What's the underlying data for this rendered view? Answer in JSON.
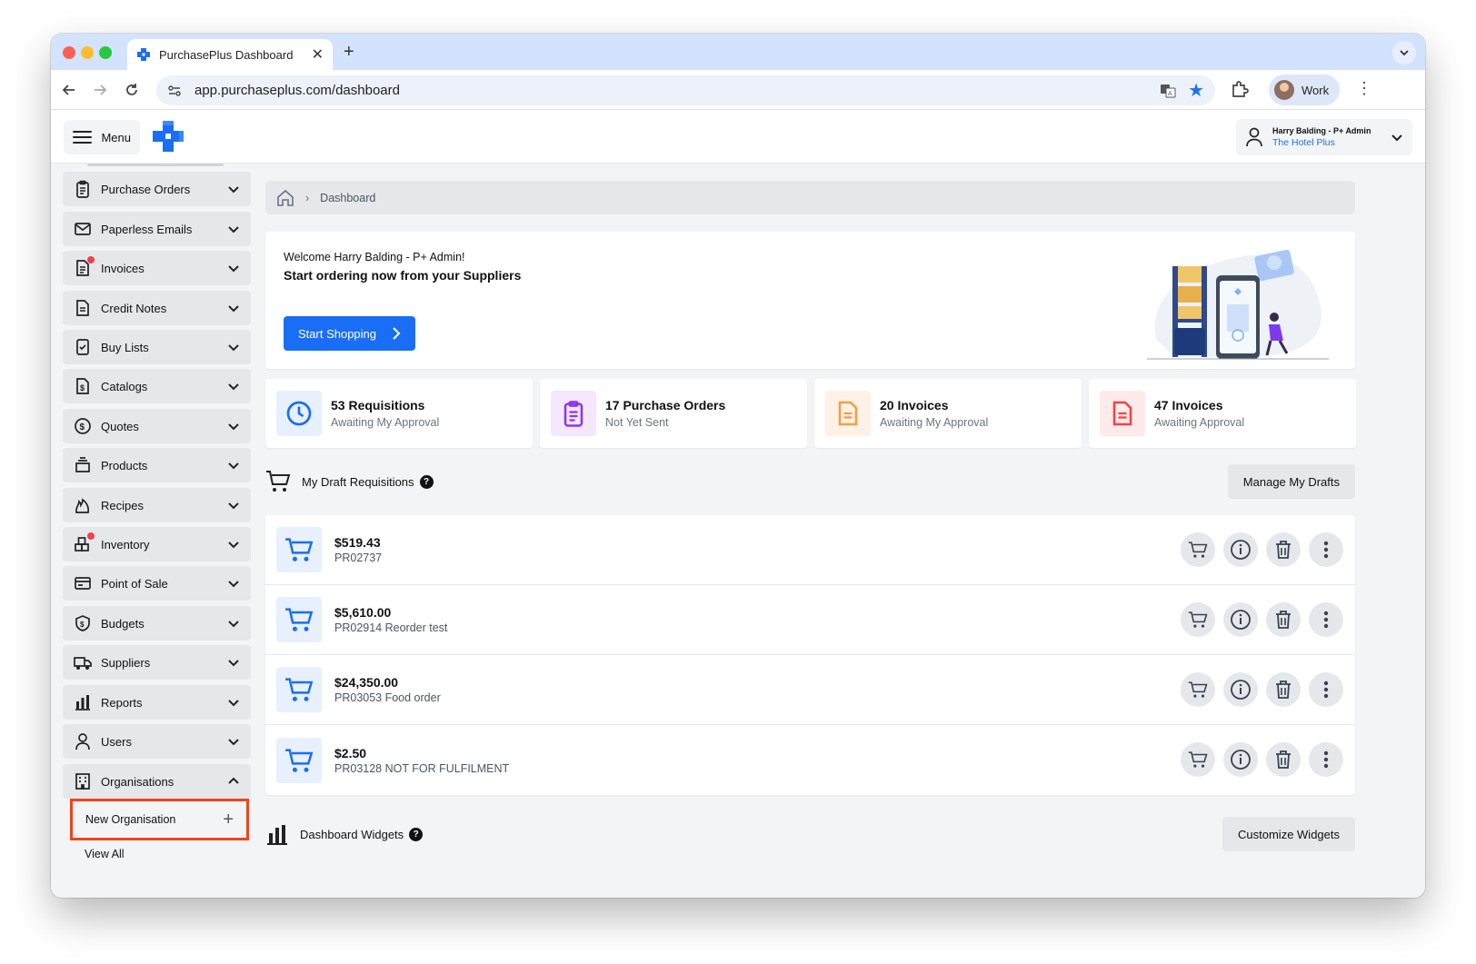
{
  "browser": {
    "tab_title": "PurchasePlus Dashboard",
    "new_tab_symbol": "+",
    "close_symbol": "✕",
    "url": "app.purchaseplus.com/dashboard",
    "profile_label": "Work"
  },
  "header": {
    "menu_label": "Menu",
    "user_name": "Harry Balding - P+ Admin",
    "organisation": "The Hotel Plus"
  },
  "sidebar": {
    "items": [
      {
        "label": "Purchase Orders",
        "icon": "clipboard-icon",
        "expanded": false
      },
      {
        "label": "Paperless Emails",
        "icon": "envelope-icon",
        "expanded": false
      },
      {
        "label": "Invoices",
        "icon": "invoice-icon",
        "expanded": false,
        "notification": true
      },
      {
        "label": "Credit Notes",
        "icon": "document-icon",
        "expanded": false
      },
      {
        "label": "Buy Lists",
        "icon": "checklist-icon",
        "expanded": false
      },
      {
        "label": "Catalogs",
        "icon": "dollar-document-icon",
        "expanded": false
      },
      {
        "label": "Quotes",
        "icon": "dollar-circle-icon",
        "expanded": false
      },
      {
        "label": "Products",
        "icon": "products-icon",
        "expanded": false
      },
      {
        "label": "Recipes",
        "icon": "flame-icon",
        "expanded": false
      },
      {
        "label": "Inventory",
        "icon": "boxes-icon",
        "expanded": false,
        "notification": true
      },
      {
        "label": "Point of Sale",
        "icon": "card-icon",
        "expanded": false
      },
      {
        "label": "Budgets",
        "icon": "shield-dollar-icon",
        "expanded": false
      },
      {
        "label": "Suppliers",
        "icon": "truck-icon",
        "expanded": false
      },
      {
        "label": "Reports",
        "icon": "bar-chart-icon",
        "expanded": false
      },
      {
        "label": "Users",
        "icon": "user-icon",
        "expanded": false
      },
      {
        "label": "Organisations",
        "icon": "building-icon",
        "expanded": true
      }
    ],
    "organisations_submenu": {
      "new_label": "New Organisation",
      "view_all_label": "View All"
    }
  },
  "breadcrumb": {
    "current": "Dashboard"
  },
  "welcome": {
    "greeting": "Welcome Harry Balding - P+ Admin!",
    "headline": "Start ordering now from your Suppliers",
    "button_label": "Start Shopping"
  },
  "stats": [
    {
      "title": "53 Requisitions",
      "subtitle": "Awaiting My Approval",
      "icon": "clock-icon",
      "color": "#1a6ef5",
      "bg": "#e8f0fd"
    },
    {
      "title": "17 Purchase Orders",
      "subtitle": "Not Yet Sent",
      "icon": "clipboard-icon",
      "color": "#9333ea",
      "bg": "#f3e8ff"
    },
    {
      "title": "20 Invoices",
      "subtitle": "Awaiting My Approval",
      "icon": "document-icon",
      "color": "#f59e42",
      "bg": "#fff1e6"
    },
    {
      "title": "47 Invoices",
      "subtitle": "Awaiting Approval",
      "icon": "document-icon",
      "color": "#ef4444",
      "bg": "#fdeaea"
    }
  ],
  "drafts": {
    "title": "My Draft Requisitions",
    "manage_label": "Manage My Drafts",
    "rows": [
      {
        "amount": "$519.43",
        "reference": "PR02737"
      },
      {
        "amount": "$5,610.00",
        "reference": "PR02914 Reorder test"
      },
      {
        "amount": "$24,350.00",
        "reference": "PR03053 Food order"
      },
      {
        "amount": "$2.50",
        "reference": "PR03128 NOT FOR FULFILMENT"
      }
    ]
  },
  "widgets": {
    "title": "Dashboard Widgets",
    "customize_label": "Customize Widgets"
  },
  "colors": {
    "accent": "#1a6ef5",
    "highlight": "#f0441a",
    "notification": "#ef4444"
  }
}
